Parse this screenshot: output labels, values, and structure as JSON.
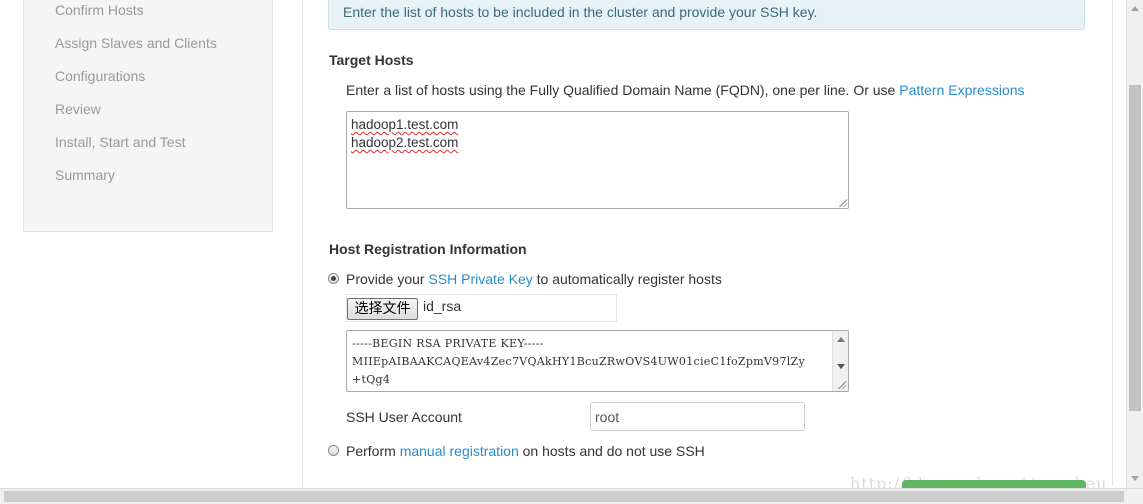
{
  "sidebar": {
    "items": [
      {
        "label": "Confirm Hosts"
      },
      {
        "label": "Assign Slaves and Clients"
      },
      {
        "label": "Configurations"
      },
      {
        "label": "Review"
      },
      {
        "label": "Install, Start and Test"
      },
      {
        "label": "Summary"
      }
    ]
  },
  "alert": {
    "text": "Enter the list of hosts to be included in the cluster and provide your SSH key."
  },
  "target_hosts": {
    "heading": "Target Hosts",
    "description": "Enter a list of hosts using the Fully Qualified Domain Name (FQDN), one per line. Or use ",
    "pattern_link": "Pattern Expressions",
    "hosts": [
      "hadoop1.test.com",
      "hadoop2.test.com"
    ]
  },
  "registration": {
    "heading": "Host Registration Information",
    "option_ssh": {
      "prefix": "Provide your ",
      "link": "SSH Private Key",
      "suffix": " to automatically register hosts"
    },
    "file_button": "选择文件",
    "file_name": "id_rsa",
    "private_key_lines": [
      "-----BEGIN RSA PRIVATE KEY-----",
      "MIIEpAIBAAKCAQEAv4Zec7VQAkHY1BcuZRwOVS4UW01cieC1foZpmV97lZy",
      "+tQg4"
    ],
    "ssh_user_label": "SSH User Account",
    "ssh_user_value": "root",
    "option_manual": {
      "prefix": "Perform ",
      "link": "manual registration",
      "suffix": " on hosts and do not use SSH"
    }
  },
  "watermark": "http://blog.csdn.net/xxx_heu"
}
